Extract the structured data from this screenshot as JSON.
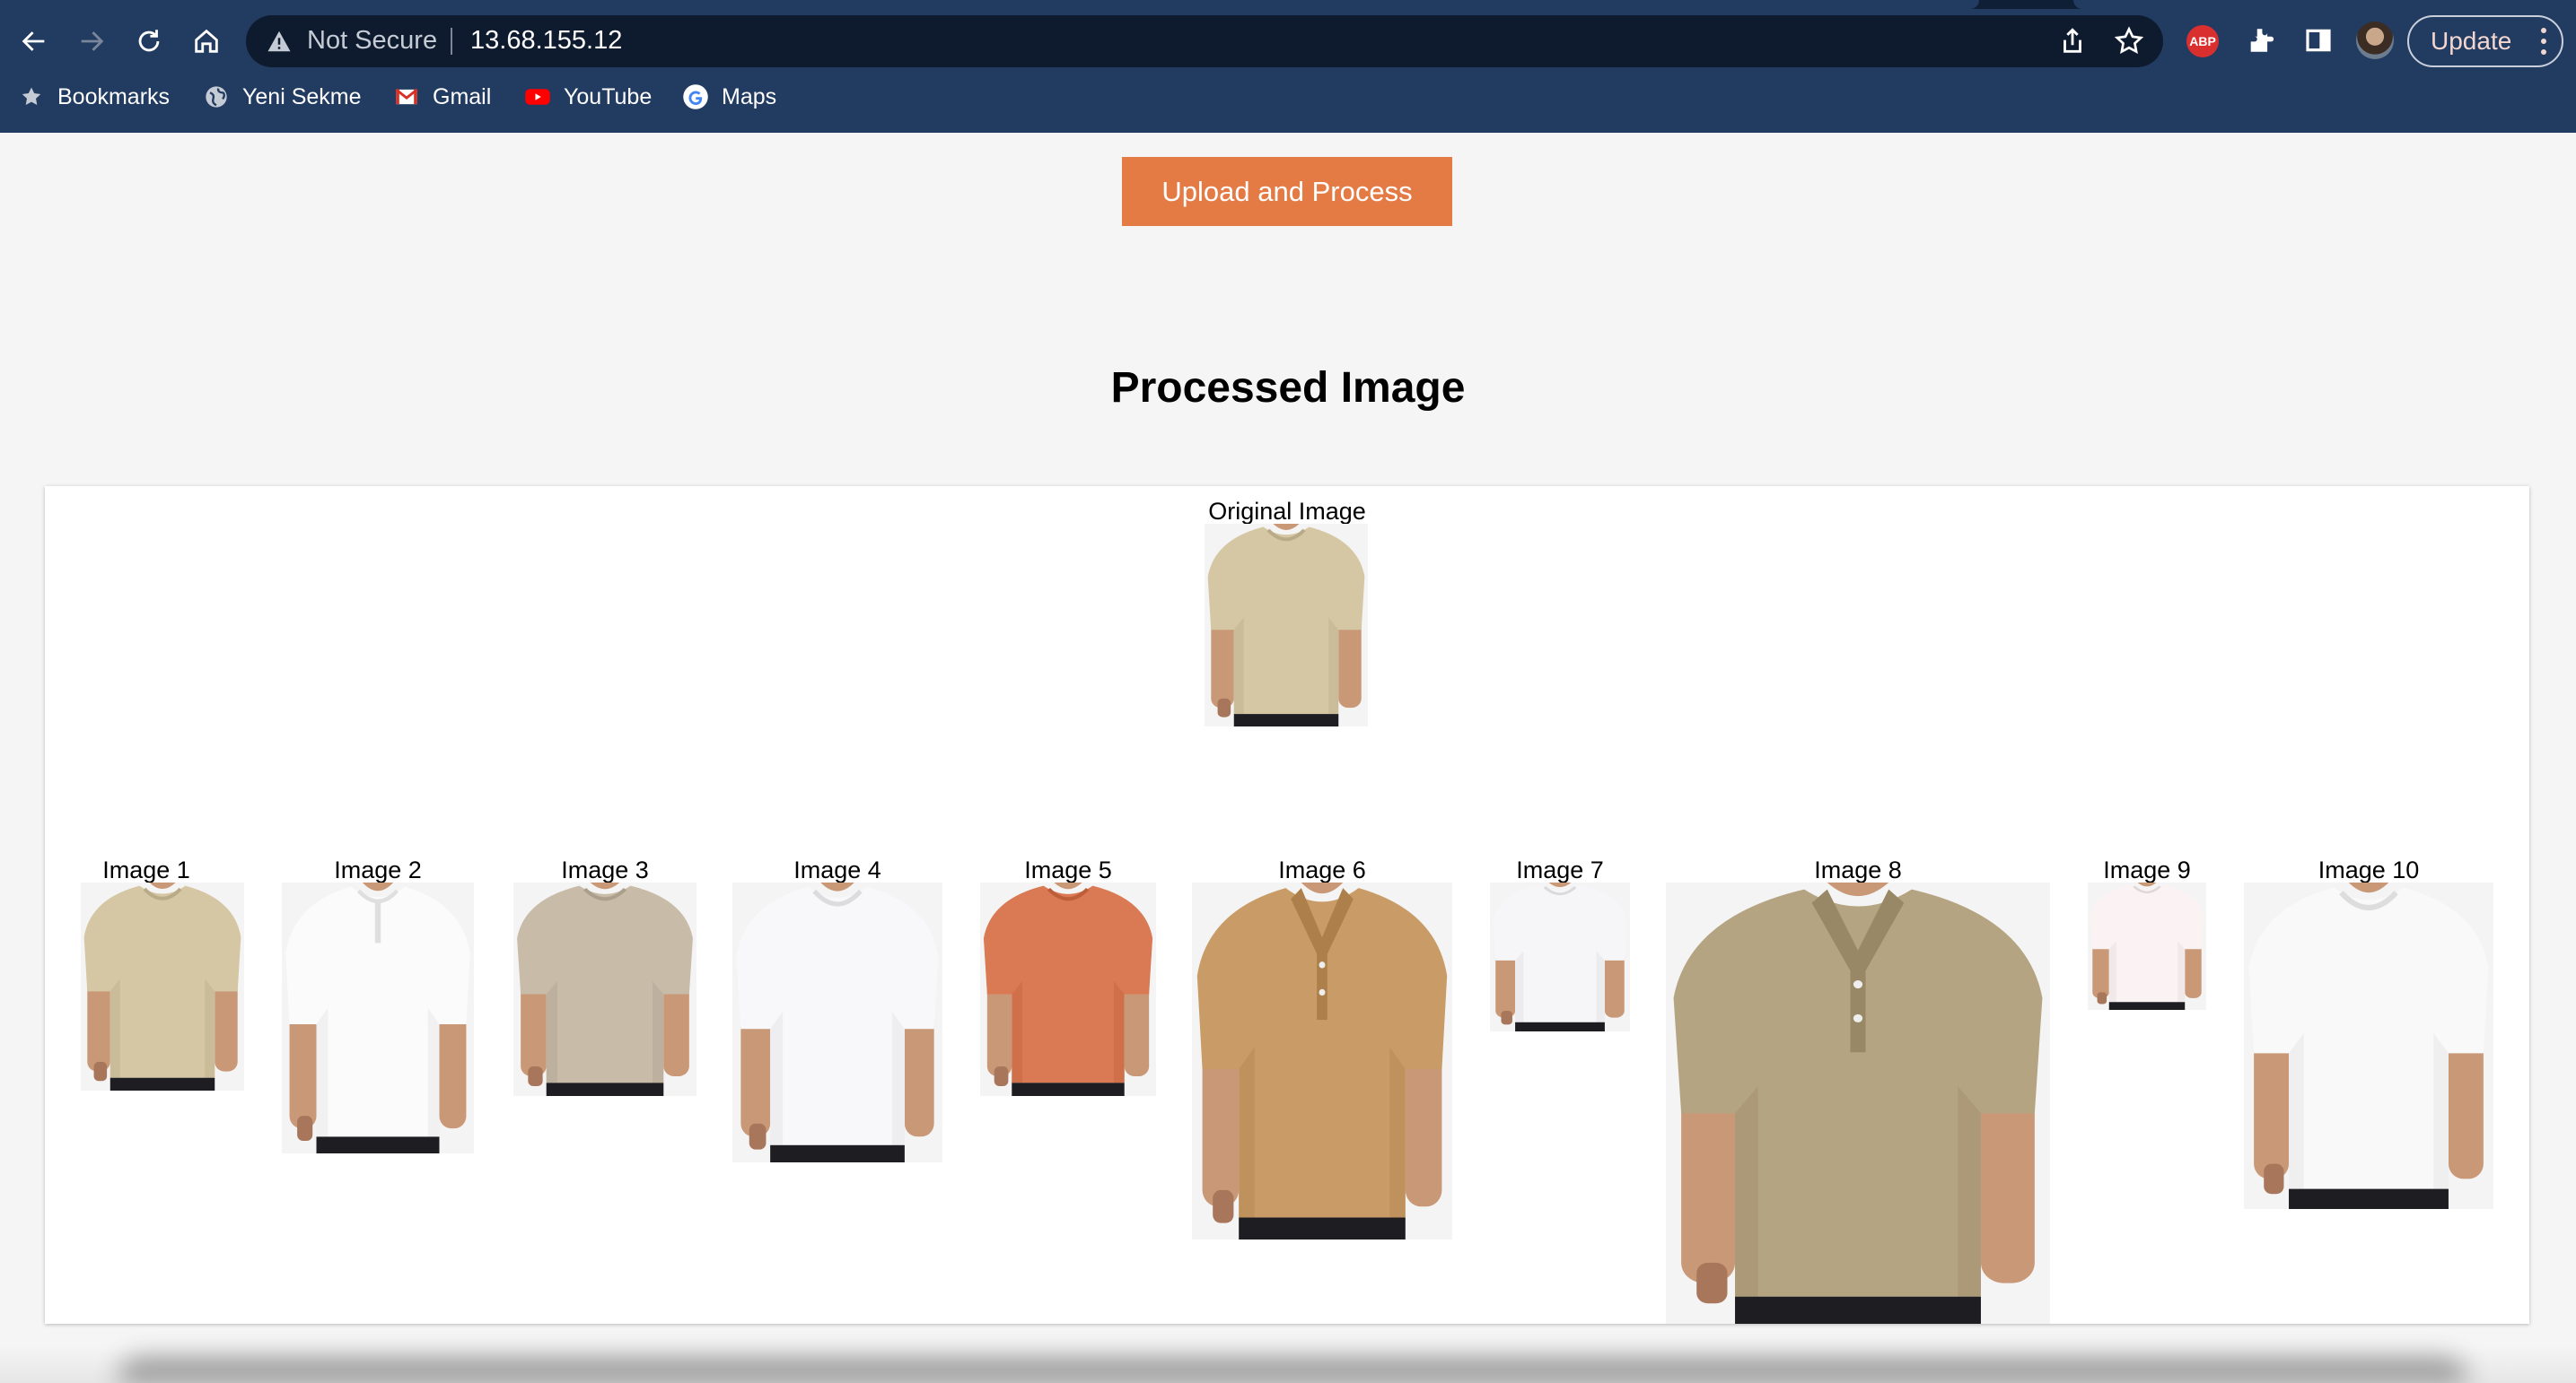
{
  "browser": {
    "security_status": "Not Secure",
    "url": "13.68.155.12",
    "update_label": "Update",
    "extension_abp": "ABP",
    "bookmarks": [
      {
        "label": "Bookmarks",
        "icon": "star-icon"
      },
      {
        "label": "Yeni Sekme",
        "icon": "globe-icon"
      },
      {
        "label": "Gmail",
        "icon": "gmail-icon"
      },
      {
        "label": "YouTube",
        "icon": "youtube-icon"
      },
      {
        "label": "Maps",
        "icon": "google-icon"
      }
    ],
    "colors": {
      "toolbar": "#213b61",
      "omnibox": "#0e1b2e"
    }
  },
  "page": {
    "upload_button": "Upload and Process",
    "title": "Processed Image",
    "original_label": "Original Image",
    "results": [
      {
        "label": "Image 1",
        "shirt_color": "#d5c6a4",
        "style": "tee"
      },
      {
        "label": "Image 2",
        "shirt_color": "#fbfbfb",
        "style": "henley"
      },
      {
        "label": "Image 3",
        "shirt_color": "#c8bba8",
        "style": "tee"
      },
      {
        "label": "Image 4",
        "shirt_color": "#f8f8fb",
        "style": "tee"
      },
      {
        "label": "Image 5",
        "shirt_color": "#d97a55",
        "style": "tee"
      },
      {
        "label": "Image 6",
        "shirt_color": "#c99b66",
        "style": "polo"
      },
      {
        "label": "Image 7",
        "shirt_color": "#f6f6f9",
        "style": "tee"
      },
      {
        "label": "Image 8",
        "shirt_color": "#b5a482",
        "style": "polo"
      },
      {
        "label": "Image 9",
        "shirt_color": "#faf2f3",
        "style": "tee"
      },
      {
        "label": "Image 10",
        "shirt_color": "#f9f9fa",
        "style": "tee"
      }
    ],
    "colors": {
      "button": "#e47b45",
      "background": "#f5f5f5"
    }
  }
}
